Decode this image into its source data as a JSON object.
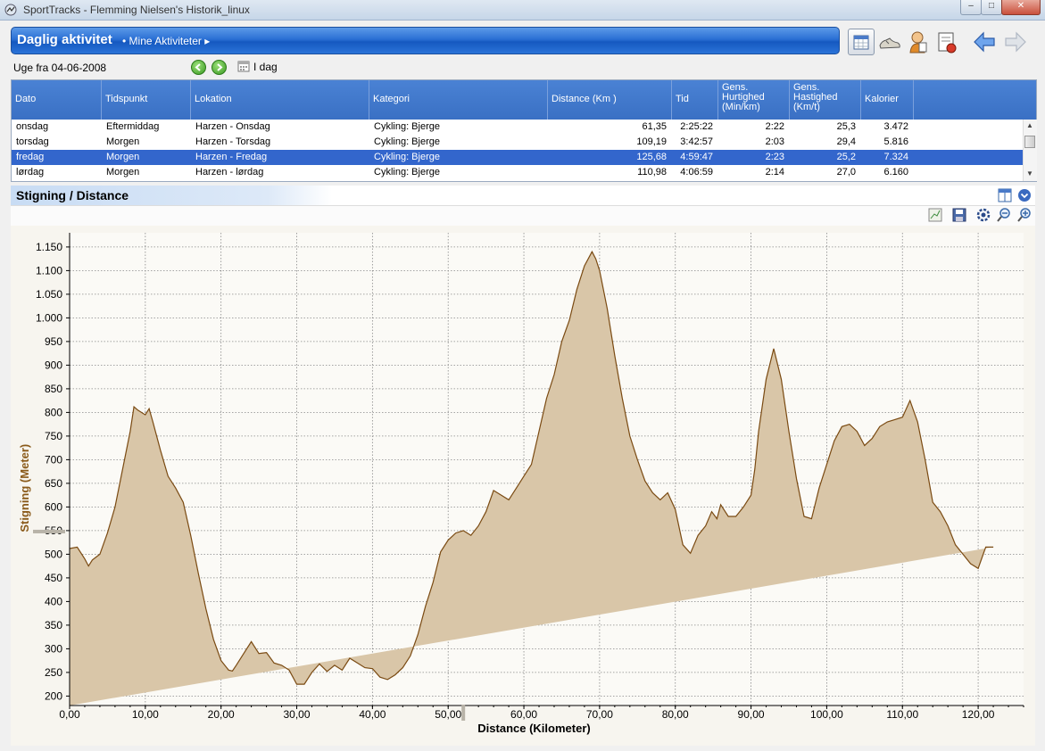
{
  "window": {
    "title": "SportTracks - Flemming Nielsen's Historik_linux",
    "min_label": "‒",
    "max_label": "□",
    "close_label": "✕"
  },
  "header": {
    "title": "Daglig aktivitet",
    "breadcrumb": "• Mine Aktiviteter  ▸"
  },
  "toolbar": {
    "icons": [
      "calendar-icon",
      "shoe-icon",
      "athlete-icon",
      "equipment-icon",
      "back-arrow-icon",
      "forward-arrow-icon"
    ]
  },
  "week": {
    "label": "Uge fra 04-06-2008",
    "today_label": "I dag"
  },
  "table": {
    "columns": [
      "Dato",
      "Tidspunkt",
      "Lokation",
      "Kategori",
      "Distance (Km )",
      "Tid",
      "Gens.\nHurtighed\n(Min/km)",
      "Gens.\nHastighed\n(Km/t)",
      "Kalorier"
    ],
    "rows": [
      [
        "onsdag",
        "Eftermiddag",
        "Harzen - Onsdag",
        "Cykling: Bjerge",
        "61,35",
        "2:25:22",
        "2:22",
        "25,3",
        "3.472"
      ],
      [
        "torsdag",
        "Morgen",
        "Harzen - Torsdag",
        "Cykling: Bjerge",
        "109,19",
        "3:42:57",
        "2:03",
        "29,4",
        "5.816"
      ],
      [
        "fredag",
        "Morgen",
        "Harzen - Fredag",
        "Cykling: Bjerge",
        "125,68",
        "4:59:47",
        "2:23",
        "25,2",
        "7.324"
      ],
      [
        "lørdag",
        "Morgen",
        "Harzen - lørdag",
        "Cykling: Bjerge",
        "110,98",
        "4:06:59",
        "2:14",
        "27,0",
        "6.160"
      ]
    ],
    "selected_row": 2
  },
  "chart_panel": {
    "title": "Stigning / Distance"
  },
  "chart_data": {
    "type": "area",
    "title": "",
    "xlabel": "Distance (Kilometer)",
    "ylabel": "Stigning (Meter)",
    "xlim": [
      0,
      126
    ],
    "ylim": [
      180,
      1180
    ],
    "x_ticks": [
      "0,00",
      "10,00",
      "20,00",
      "30,00",
      "40,00",
      "50,00",
      "60,00",
      "70,00",
      "80,00",
      "90,00",
      "100,00",
      "110,00",
      "120,00"
    ],
    "y_ticks": [
      "200",
      "250",
      "300",
      "350",
      "400",
      "450",
      "500",
      "550",
      "600",
      "650",
      "700",
      "750",
      "800",
      "850",
      "900",
      "950",
      "1.000",
      "1.050",
      "1.100",
      "1.150"
    ],
    "grid": true,
    "colors": {
      "fill": "#d9c6a8",
      "line": "#7a4a12",
      "axis_label": "#8a5a1a"
    },
    "x": [
      0,
      1,
      2,
      2.5,
      3,
      4,
      5,
      6,
      7,
      8,
      8.5,
      9,
      10,
      10.5,
      11,
      12,
      13,
      14,
      15,
      16,
      17,
      18,
      19,
      20,
      21,
      21.5,
      22,
      23,
      24,
      25,
      26,
      27,
      28,
      29,
      30,
      31,
      32,
      33,
      34,
      35,
      36,
      37,
      38,
      39,
      40,
      41,
      42,
      43,
      44,
      45,
      46,
      47,
      48,
      49,
      50,
      51,
      52,
      53,
      54,
      55,
      56,
      57,
      58,
      59,
      60,
      61,
      62,
      63,
      64,
      65,
      66,
      67,
      68,
      69,
      69.5,
      70,
      71,
      72,
      73,
      74,
      75,
      76,
      77,
      78,
      79,
      80,
      81,
      82,
      83,
      84,
      84.8,
      85.5,
      86,
      87,
      88,
      89,
      90,
      90.5,
      91,
      92,
      93,
      94,
      95,
      96,
      97,
      98,
      99,
      100,
      101,
      102,
      103,
      104,
      105,
      106,
      107,
      108,
      109,
      110,
      111,
      112,
      113,
      114,
      115,
      116,
      117,
      118,
      119,
      120,
      121,
      122,
      123,
      124,
      125,
      126
    ],
    "y": [
      512,
      515,
      490,
      475,
      488,
      500,
      545,
      600,
      680,
      760,
      812,
      805,
      795,
      808,
      780,
      720,
      665,
      640,
      610,
      540,
      460,
      385,
      320,
      275,
      255,
      253,
      265,
      290,
      315,
      290,
      292,
      270,
      265,
      255,
      225,
      225,
      250,
      268,
      252,
      265,
      255,
      280,
      270,
      260,
      258,
      240,
      235,
      245,
      260,
      285,
      330,
      390,
      440,
      505,
      530,
      545,
      550,
      540,
      560,
      590,
      635,
      625,
      615,
      640,
      665,
      690,
      760,
      830,
      880,
      950,
      995,
      1060,
      1110,
      1140,
      1125,
      1100,
      1020,
      920,
      830,
      750,
      700,
      655,
      630,
      615,
      630,
      595,
      520,
      502,
      540,
      560,
      590,
      575,
      605,
      580,
      580,
      600,
      625,
      680,
      760,
      870,
      935,
      870,
      760,
      660,
      580,
      575,
      640,
      690,
      740,
      770,
      775,
      760,
      730,
      745,
      770,
      780,
      785,
      790,
      825,
      780,
      700,
      610,
      590,
      560,
      520,
      500,
      480,
      470,
      515,
      515
    ]
  }
}
